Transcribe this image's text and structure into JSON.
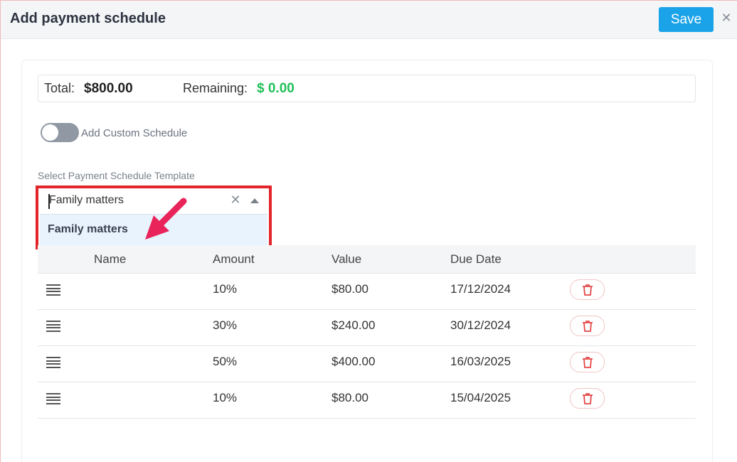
{
  "header": {
    "title": "Add payment schedule",
    "save_label": "Save",
    "close_glyph": "✕"
  },
  "totals": {
    "total_label": "Total:",
    "total_value": "$800.00",
    "remaining_label": "Remaining:",
    "remaining_value": "$ 0.00"
  },
  "custom_schedule": {
    "label": "Add Custom Schedule",
    "enabled": false
  },
  "template_select": {
    "label": "Select Payment Schedule Template",
    "value": "Family matters",
    "clear_glyph": "✕",
    "options": [
      "Family matters"
    ]
  },
  "table": {
    "columns": [
      "Name",
      "Amount",
      "Value",
      "Due Date"
    ],
    "rows": [
      {
        "name": "",
        "amount": "10%",
        "value": "$80.00",
        "due_date": "17/12/2024"
      },
      {
        "name": "",
        "amount": "30%",
        "value": "$240.00",
        "due_date": "30/12/2024"
      },
      {
        "name": "",
        "amount": "50%",
        "value": "$400.00",
        "due_date": "16/03/2025"
      },
      {
        "name": "",
        "amount": "10%",
        "value": "$80.00",
        "due_date": "15/04/2025"
      }
    ]
  },
  "icons": {
    "close": "close-icon",
    "clear": "clear-icon",
    "caret": "caret-up-icon",
    "drag": "drag-handle-icon",
    "delete": "trash-icon"
  },
  "colors": {
    "accent": "#1aa3e8",
    "remaining": "#21c05a",
    "highlight": "#e3242b",
    "arrow": "#e8245a",
    "delete": "#e34848"
  }
}
